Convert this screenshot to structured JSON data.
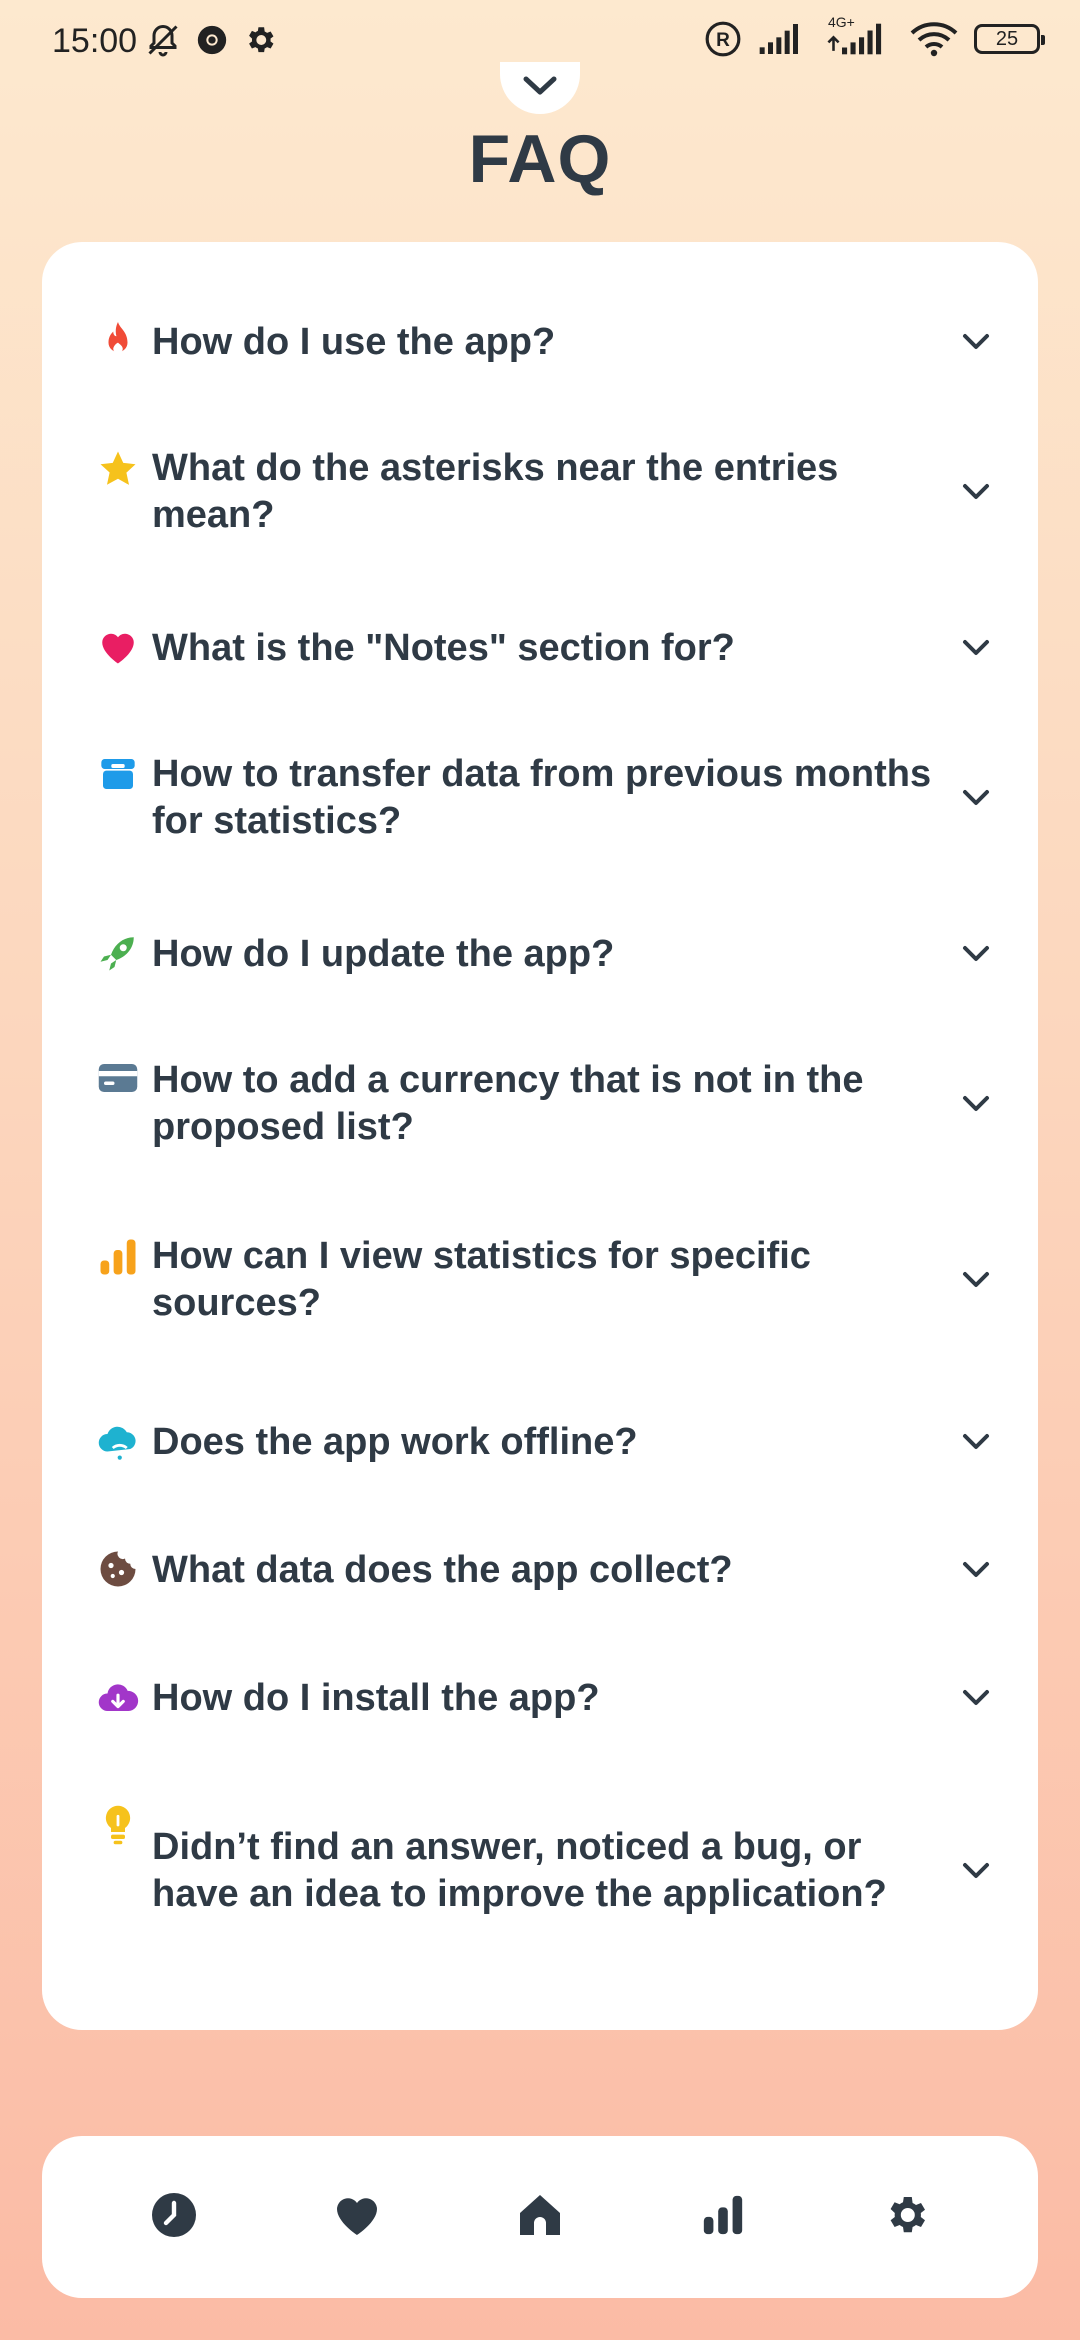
{
  "status_bar": {
    "time": "15:00",
    "battery": "25",
    "network_label": "4G+",
    "icons": [
      "bell-muted-icon",
      "chrome-icon",
      "gear-icon",
      "registered-icon",
      "signal-icon",
      "signal-4g-icon",
      "wifi-icon",
      "battery-icon"
    ]
  },
  "header": {
    "title": "FAQ",
    "handle_icon": "chevron-down-icon"
  },
  "faq": {
    "items": [
      {
        "icon": "fire-icon",
        "icon_color": "#f04b37",
        "question": "How do I use the app?"
      },
      {
        "icon": "star-icon",
        "icon_color": "#f6c21c",
        "question": "What do the asterisks near the entries mean?"
      },
      {
        "icon": "heart-icon",
        "icon_color": "#e91e63",
        "question": "What is the \"Notes\" section for?"
      },
      {
        "icon": "archive-icon",
        "icon_color": "#1e9be9",
        "question": "How to transfer data from previous months for statistics?"
      },
      {
        "icon": "rocket-icon",
        "icon_color": "#4caf50",
        "question": "How do I update the app?"
      },
      {
        "icon": "card-icon",
        "icon_color": "#5b7a93",
        "question": "How to add a currency that is not in the proposed list?"
      },
      {
        "icon": "bar-chart-icon",
        "icon_color": "#f7a21b",
        "question": "How can I view statistics for specific sources?"
      },
      {
        "icon": "cloud-wifi-icon",
        "icon_color": "#1eb2d0",
        "question": "Does the app work offline?"
      },
      {
        "icon": "cookie-icon",
        "icon_color": "#6d4c41",
        "question": "What data does the app collect?"
      },
      {
        "icon": "cloud-download-icon",
        "icon_color": "#a236c9",
        "question": "How do I install the app?"
      },
      {
        "icon": "lightbulb-icon",
        "icon_color": "#f6c21c",
        "question": "Didn’t find an answer, noticed a bug, or have an idea to improve the application?"
      }
    ]
  },
  "bottom_nav": {
    "items": [
      "clock-icon",
      "heart-icon",
      "home-icon",
      "bar-chart-icon",
      "gear-icon"
    ],
    "icon_color": "#2f3a45"
  }
}
